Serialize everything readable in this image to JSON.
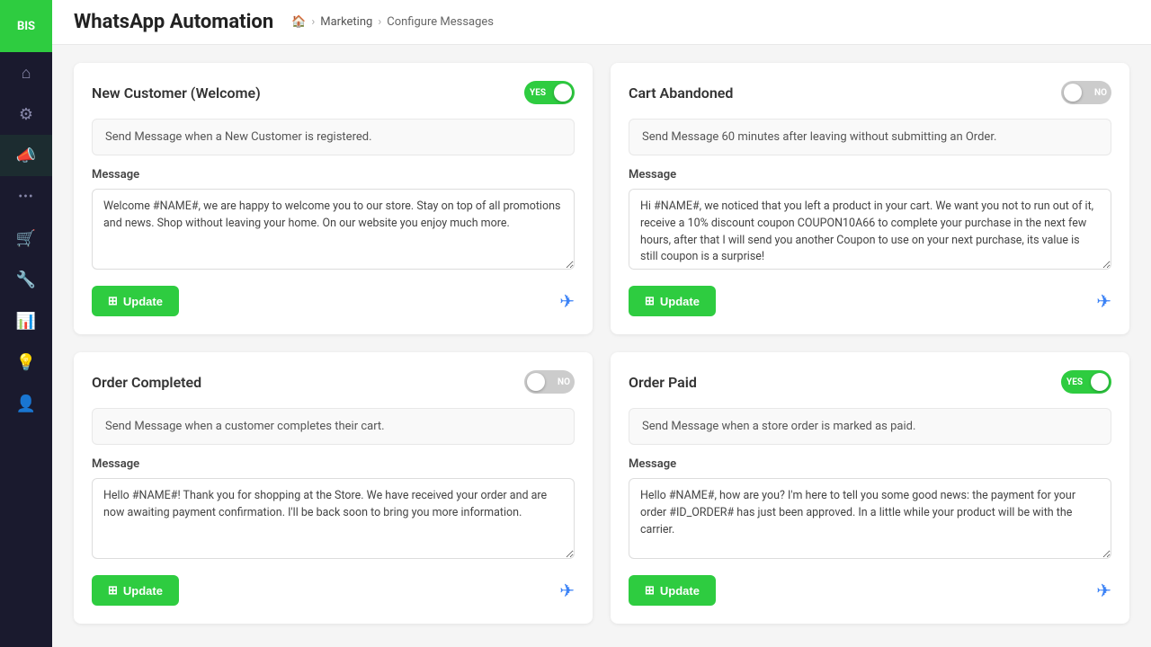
{
  "app": {
    "logo": "BIS",
    "title": "WhatsApp Automation"
  },
  "breadcrumb": {
    "home": "🏠",
    "marketing": "Marketing",
    "current": "Configure Messages"
  },
  "sidebar": {
    "items": [
      {
        "id": "home",
        "icon": "⌂",
        "active": false
      },
      {
        "id": "settings",
        "icon": "⚙",
        "active": false
      },
      {
        "id": "marketing",
        "icon": "📢",
        "active": true
      },
      {
        "id": "more",
        "icon": "···",
        "active": false
      },
      {
        "id": "cart",
        "icon": "🛒",
        "active": false
      },
      {
        "id": "wrench",
        "icon": "🔧",
        "active": false
      },
      {
        "id": "chart",
        "icon": "📊",
        "active": false
      },
      {
        "id": "bulb",
        "icon": "💡",
        "active": false
      },
      {
        "id": "user",
        "icon": "👤",
        "active": false
      }
    ]
  },
  "cards": [
    {
      "id": "new-customer",
      "title": "New Customer (Welcome)",
      "toggle": "on",
      "toggle_label_on": "YES",
      "toggle_label_off": "NO",
      "description": "Send Message when a New Customer is registered.",
      "message_label": "Message",
      "message": "Welcome #NAME#, we are happy to welcome you to our store. Stay on top of all promotions and news. Shop without leaving your home. On our website you enjoy much more.",
      "update_label": "Update"
    },
    {
      "id": "cart-abandoned",
      "title": "Cart Abandoned",
      "toggle": "off",
      "toggle_label_on": "YES",
      "toggle_label_off": "NO",
      "description": "Send Message 60 minutes after leaving without submitting an Order.",
      "message_label": "Message",
      "message": "Hi #NAME#, we noticed that you left a product in your cart. We want you not to run out of it, receive a 10% discount coupon COUPON10A66 to complete your purchase in the next few hours, after that I will send you another Coupon to use on your next purchase, its value is still coupon is a surprise!",
      "update_label": "Update"
    },
    {
      "id": "order-completed",
      "title": "Order Completed",
      "toggle": "off",
      "toggle_label_on": "YES",
      "toggle_label_off": "NO",
      "description": "Send Message when a customer completes their cart.",
      "message_label": "Message",
      "message": "Hello #NAME#! Thank you for shopping at the Store. We have received your order and are now awaiting payment confirmation. I'll be back soon to bring you more information.",
      "update_label": "Update"
    },
    {
      "id": "order-paid",
      "title": "Order Paid",
      "toggle": "on",
      "toggle_label_on": "YES",
      "toggle_label_off": "NO",
      "description": "Send Message when a store order is marked as paid.",
      "message_label": "Message",
      "message": "Hello #NAME#, how are you? I'm here to tell you some good news: the payment for your order #ID_ORDER# has just been approved. In a little while your product will be with the carrier.",
      "update_label": "Update"
    }
  ]
}
